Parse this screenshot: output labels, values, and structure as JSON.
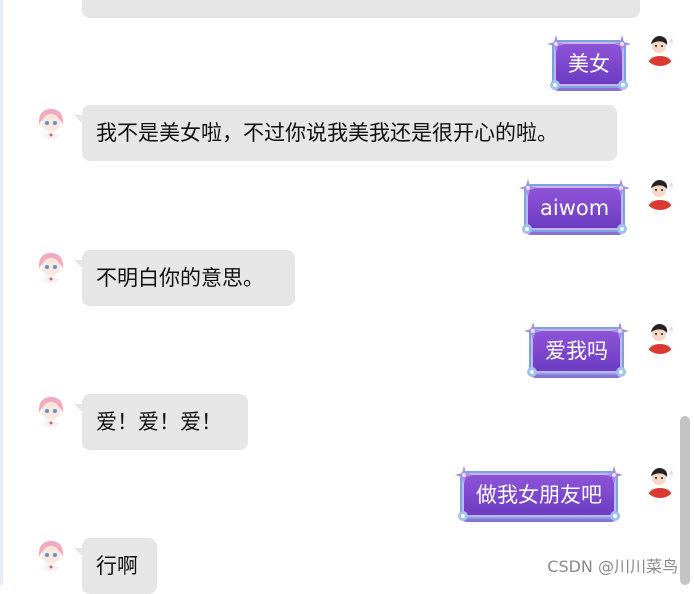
{
  "chat": {
    "messages": [
      {
        "sender": "user",
        "text": "美女"
      },
      {
        "sender": "bot",
        "text": "我不是美女啦，不过你说我美我还是很开心的啦。"
      },
      {
        "sender": "user",
        "text": "aiwom"
      },
      {
        "sender": "bot",
        "text": "不明白你的意思。"
      },
      {
        "sender": "user",
        "text": "爱我吗"
      },
      {
        "sender": "bot",
        "text": "爱！爱！爱！"
      },
      {
        "sender": "user",
        "text": "做我女朋友吧"
      },
      {
        "sender": "bot",
        "text": "行啊"
      }
    ]
  },
  "watermark": "CSDN @川川菜鸟",
  "colors": {
    "user_bubble": "#7a46cc",
    "bot_bubble": "#e6e6e6",
    "scrollbar": "#c4c4c4"
  },
  "icons": {
    "user_avatar": "boy-avatar-icon",
    "bot_avatar": "anime-girl-avatar-icon",
    "bubble_decoration": "star-flower-icon"
  }
}
